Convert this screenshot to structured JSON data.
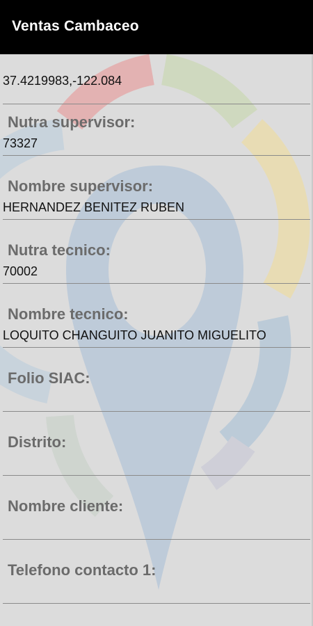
{
  "app": {
    "title": "Ventas Cambaceo"
  },
  "icons": {
    "background": "location-pin-logo-icon"
  },
  "colors": {
    "appbar": "#000000",
    "background": "#dcdcdc",
    "logo_blue": "#8fb3d6",
    "logo_red": "#e08a8a",
    "logo_green": "#bcd0a0",
    "logo_yellow": "#f0d488"
  },
  "form": {
    "coordinates": "37.4219983,-122.084",
    "supervisor_number": {
      "label": "Nutra supervisor:",
      "value": "73327"
    },
    "supervisor_name": {
      "label": "Nombre supervisor:",
      "value": "HERNANDEZ BENITEZ RUBEN"
    },
    "technician_number": {
      "label": "Nutra tecnico:",
      "value": "70002"
    },
    "technician_name": {
      "label": "Nombre tecnico:",
      "value": "LOQUITO CHANGUITO JUANITO MIGUELITO"
    },
    "folio_siac": {
      "label": "Folio SIAC:",
      "value": ""
    },
    "district": {
      "label": "Distrito:",
      "value": ""
    },
    "client_name": {
      "label": "Nombre cliente:",
      "value": ""
    },
    "contact_phone_1": {
      "label": "Telefono contacto 1:",
      "value": ""
    }
  }
}
